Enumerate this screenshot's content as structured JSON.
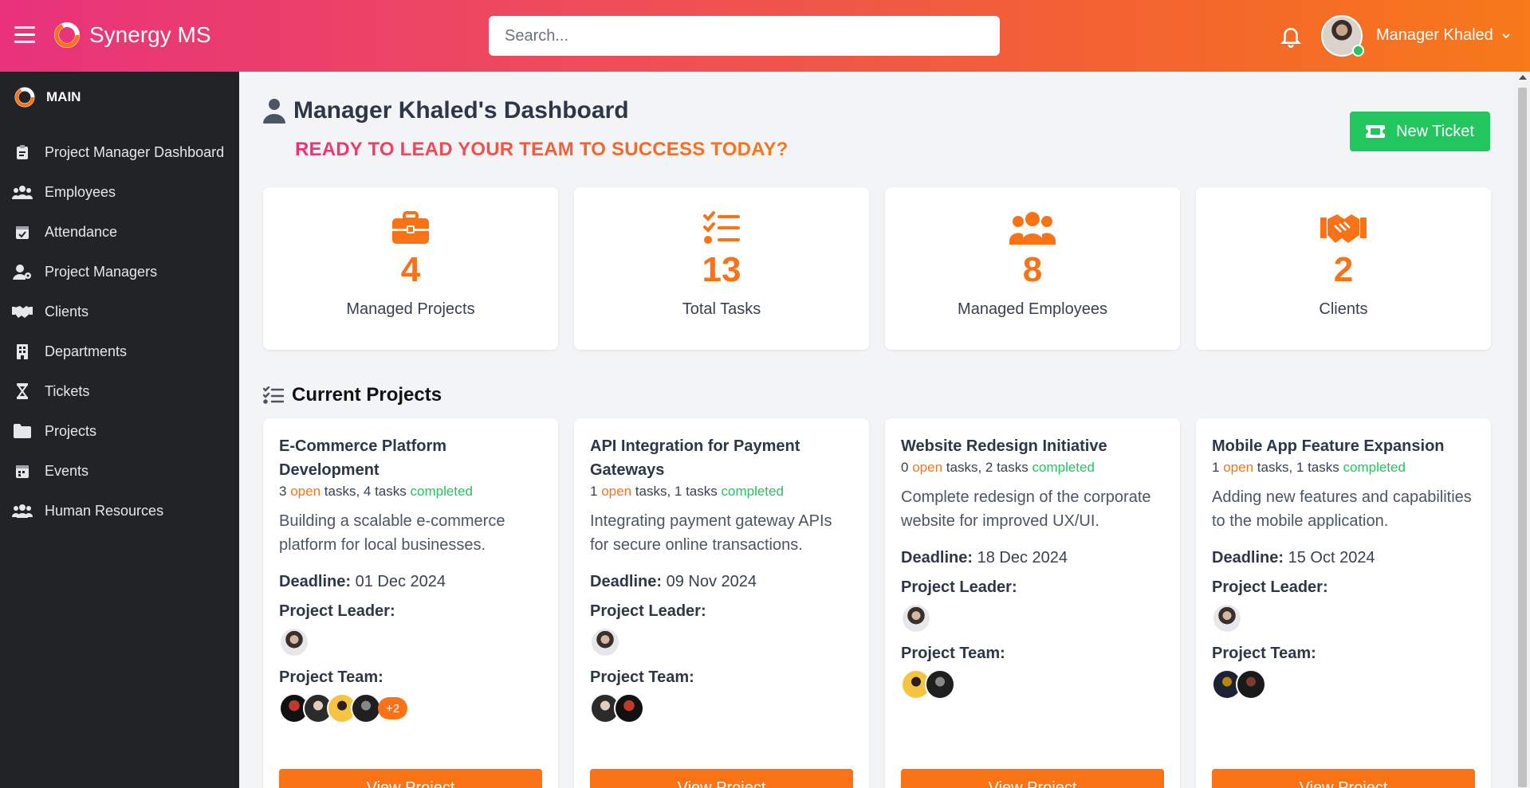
{
  "header": {
    "brand": "Synergy MS",
    "search_placeholder": "Search...",
    "user_name": "Manager Khaled",
    "chevron": "⌄",
    "colors": {
      "gradient_start": "#e8327c",
      "gradient_end": "#f7791a"
    }
  },
  "sidebar": {
    "section": "MAIN",
    "items": [
      {
        "label": "Project Manager Dashboard",
        "icon": "clipboard-icon"
      },
      {
        "label": "Employees",
        "icon": "users-icon"
      },
      {
        "label": "Attendance",
        "icon": "calendar-check-icon"
      },
      {
        "label": "Project Managers",
        "icon": "user-gear-icon"
      },
      {
        "label": "Clients",
        "icon": "handshake-icon"
      },
      {
        "label": "Departments",
        "icon": "building-icon"
      },
      {
        "label": "Tickets",
        "icon": "hourglass-icon"
      },
      {
        "label": "Projects",
        "icon": "folder-icon"
      },
      {
        "label": "Events",
        "icon": "calendar-icon"
      },
      {
        "label": "Human Resources",
        "icon": "people-group-icon"
      }
    ]
  },
  "dashboard": {
    "title": "Manager Khaled's Dashboard",
    "slogan": "READY TO LEAD YOUR TEAM TO SUCCESS TODAY?",
    "new_ticket_label": "New Ticket",
    "stats": [
      {
        "value": "4",
        "label": "Managed Projects",
        "icon": "briefcase-icon"
      },
      {
        "value": "13",
        "label": "Total Tasks",
        "icon": "list-check-icon"
      },
      {
        "value": "8",
        "label": "Managed Employees",
        "icon": "users-icon"
      },
      {
        "value": "2",
        "label": "Clients",
        "icon": "handshake-icon"
      }
    ],
    "projects_title": "Current Projects",
    "projects": [
      {
        "name": "E-Commerce Platform Development",
        "open_count": "3",
        "open_word": "open",
        "tasks_mid": "tasks,",
        "done_count": "4 tasks",
        "done_word": "completed",
        "description": "Building a scalable e-commerce platform for local businesses.",
        "deadline_label": "Deadline:",
        "deadline": "01 Dec 2024",
        "leader_label": "Project Leader:",
        "team_label": "Project Team:",
        "team_more": "+2",
        "view_label": "View Project"
      },
      {
        "name": "API Integration for Payment Gateways",
        "open_count": "1",
        "open_word": "open",
        "tasks_mid": "tasks,",
        "done_count": "1 tasks",
        "done_word": "completed",
        "description": "Integrating payment gateway APIs for secure online transactions.",
        "deadline_label": "Deadline:",
        "deadline": "09 Nov 2024",
        "leader_label": "Project Leader:",
        "team_label": "Project Team:",
        "team_more": "",
        "view_label": "View Project"
      },
      {
        "name": "Website Redesign Initiative",
        "open_count": "0",
        "open_word": "open",
        "tasks_mid": "tasks,",
        "done_count": "2 tasks",
        "done_word": "completed",
        "description": "Complete redesign of the corporate website for improved UX/UI.",
        "deadline_label": "Deadline:",
        "deadline": "18 Dec 2024",
        "leader_label": "Project Leader:",
        "team_label": "Project Team:",
        "team_more": "",
        "view_label": "View Project"
      },
      {
        "name": "Mobile App Feature Expansion",
        "open_count": "1",
        "open_word": "open",
        "tasks_mid": "tasks,",
        "done_count": "1 tasks",
        "done_word": "completed",
        "description": "Adding new features and capabilities to the mobile application.",
        "deadline_label": "Deadline:",
        "deadline": "15 Oct 2024",
        "leader_label": "Project Leader:",
        "team_label": "Project Team:",
        "team_more": "",
        "view_label": "View Project"
      }
    ]
  }
}
